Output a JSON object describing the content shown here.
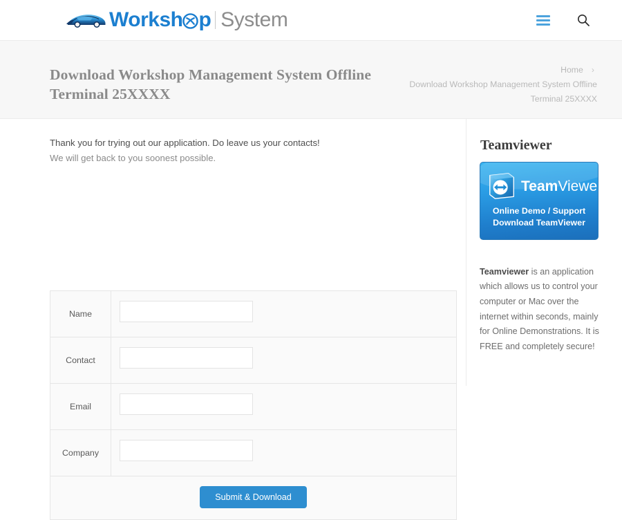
{
  "header": {
    "logo": {
      "car_icon": "sports-car-icon",
      "text_primary": "Worksh",
      "text_o": "o",
      "text_primary_tail": "p",
      "text_secondary": "System"
    },
    "menu_icon": "hamburger-menu-icon",
    "search_icon": "search-icon",
    "accent_color": "#1c7fd0",
    "menu_color": "#4ca3dd"
  },
  "title_band": {
    "page_title": "Download Workshop Management System Offline Terminal 25XXXX",
    "breadcrumb": {
      "home": "Home",
      "separator": "›",
      "current": "Download Workshop Management System Offline Terminal 25XXXX"
    }
  },
  "main": {
    "intro_line1": "Thank you for trying out our application. Do leave us your contacts!",
    "intro_line2": "We will get back to you soonest possible.",
    "form": {
      "fields": [
        {
          "label": "Name",
          "value": "",
          "placeholder": ""
        },
        {
          "label": "Contact",
          "value": "",
          "placeholder": ""
        },
        {
          "label": "Email",
          "value": "",
          "placeholder": ""
        },
        {
          "label": "Company",
          "value": "",
          "placeholder": ""
        }
      ],
      "submit_label": "Submit & Download",
      "submit_color": "#2e8ed0"
    }
  },
  "aside": {
    "heading": "Teamviewer",
    "banner": {
      "logo_icon": "teamviewer-logo-icon",
      "wordmark_bold": "Team",
      "wordmark_light": "Viewer",
      "line1": "Online Demo / Support",
      "line2": "Download TeamViewer",
      "background_color": "#1f8ed6"
    },
    "description_lead": "Teamviewer",
    "description_rest": " is an application which allows us to control your computer or Mac over the internet within seconds, mainly for Online Demonstrations. It is FREE and completely secure!"
  }
}
